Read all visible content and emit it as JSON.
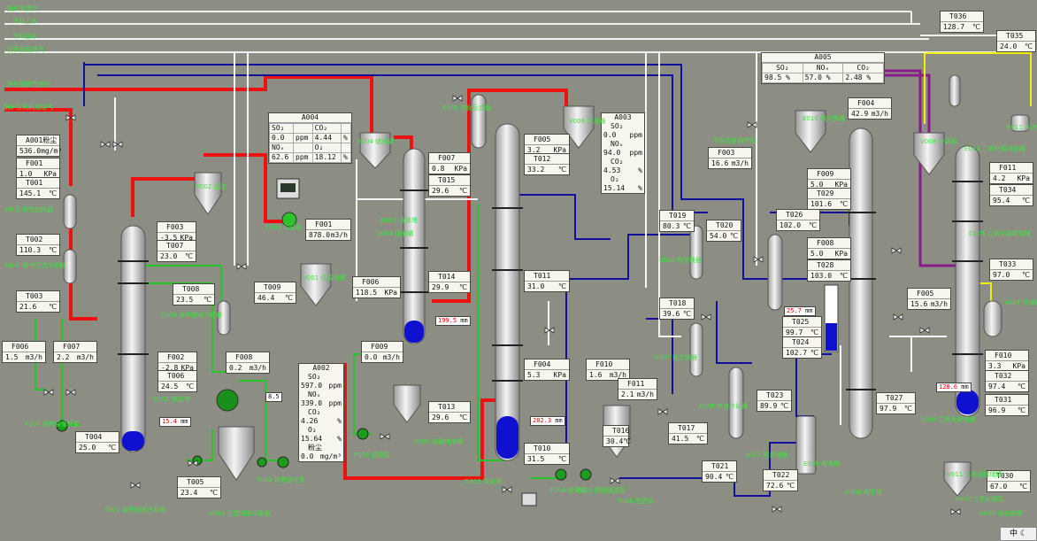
{
  "line_labels": {
    "l1": "锅炉来蒸汽",
    "l2": "冷却上水",
    "l3": "冷却回水",
    "l4": "仪表自控蒸汽",
    "l5": "净化烟道气放空",
    "l6": "锅炉引风机烟道气"
  },
  "readouts": {
    "A001": {
      "tag": "A001粉尘",
      "value": "536.0",
      "unit": "mg/m³"
    },
    "F001a": {
      "tag": "F001",
      "value": "1.0",
      "unit": "KPa"
    },
    "T001": {
      "tag": "T001",
      "value": "145.1",
      "unit": "℃"
    },
    "T002": {
      "tag": "T002",
      "value": "110.3",
      "unit": "℃"
    },
    "T003": {
      "tag": "T003",
      "value": "21.6",
      "unit": "℃"
    },
    "F006": {
      "tag": "F006",
      "value": "1.5",
      "unit": "m3/h"
    },
    "F007": {
      "tag": "F007",
      "value": "2.2",
      "unit": "m3/h"
    },
    "T004": {
      "tag": "T004",
      "value": "25.0",
      "unit": "℃"
    },
    "F003a": {
      "tag": "F003",
      "value": "-3.5",
      "unit": "KPa"
    },
    "T007": {
      "tag": "T007",
      "value": "23.0",
      "unit": "℃"
    },
    "T008": {
      "tag": "T008",
      "value": "23.5",
      "unit": "℃"
    },
    "F002": {
      "tag": "F002",
      "value": "-2.8",
      "unit": "KPa"
    },
    "T006": {
      "tag": "T006",
      "value": "24.5",
      "unit": "℃"
    },
    "F008": {
      "tag": "F008",
      "value": "0.2",
      "unit": "m3/h"
    },
    "T005": {
      "tag": "T005",
      "value": "23.4",
      "unit": "℃"
    },
    "T009": {
      "tag": "T009",
      "value": "46.4",
      "unit": "℃"
    },
    "F001b": {
      "tag": "F001",
      "value": "878.0",
      "unit": "m3/h"
    },
    "F007b": {
      "tag": "F007",
      "value": "0.8",
      "unit": "KPa"
    },
    "T015": {
      "tag": "T015",
      "value": "29.6",
      "unit": "℃"
    },
    "F006b": {
      "tag": "F006",
      "value": "118.5",
      "unit": "KPa"
    },
    "T014": {
      "tag": "T014",
      "value": "29.9",
      "unit": "℃"
    },
    "F009": {
      "tag": "F009",
      "value": "0.0",
      "unit": "m3/h"
    },
    "T013": {
      "tag": "T013",
      "value": "29.6",
      "unit": "℃"
    },
    "F005": {
      "tag": "F005",
      "value": "3.2",
      "unit": "KPa"
    },
    "T012": {
      "tag": "T012",
      "value": "33.2",
      "unit": "℃"
    },
    "T011": {
      "tag": "T011",
      "value": "31.0",
      "unit": "℃"
    },
    "F004": {
      "tag": "F004",
      "value": "5.3",
      "unit": "KPa"
    },
    "T010": {
      "tag": "T010",
      "value": "31.5",
      "unit": "℃"
    },
    "F010": {
      "tag": "F010",
      "value": "1.6",
      "unit": "m3/h"
    },
    "F011": {
      "tag": "F011",
      "value": "2.1",
      "unit": "m3/h"
    },
    "T016": {
      "tag": "T016",
      "value": "30.4",
      "unit": "℃"
    },
    "T017": {
      "tag": "T017",
      "value": "41.5",
      "unit": "℃"
    },
    "T019": {
      "tag": "T019",
      "value": "80.3",
      "unit": "℃"
    },
    "T020": {
      "tag": "T020",
      "value": "54.0",
      "unit": "℃"
    },
    "T018": {
      "tag": "T018",
      "value": "39.6",
      "unit": "℃"
    },
    "T021": {
      "tag": "T021",
      "value": "90.4",
      "unit": "℃"
    },
    "T022": {
      "tag": "T022",
      "value": "72.6",
      "unit": "℃"
    },
    "T023": {
      "tag": "T023",
      "value": "89.9",
      "unit": "℃"
    },
    "F003b": {
      "tag": "F003",
      "value": "16.6",
      "unit": "m3/h"
    },
    "F004b": {
      "tag": "F004",
      "value": "42.9",
      "unit": "m3/h"
    },
    "F009b": {
      "tag": "F009",
      "value": "5.0",
      "unit": "KPa"
    },
    "T029": {
      "tag": "T029",
      "value": "101.6",
      "unit": "℃"
    },
    "T026": {
      "tag": "T026",
      "value": "102.0",
      "unit": "℃"
    },
    "F008b": {
      "tag": "F008",
      "value": "5.0",
      "unit": "KPa"
    },
    "T028": {
      "tag": "T028",
      "value": "103.0",
      "unit": "℃"
    },
    "T025": {
      "tag": "T025",
      "value": "99.7",
      "unit": "℃"
    },
    "T024": {
      "tag": "T024",
      "value": "102.7",
      "unit": "℃"
    },
    "T027": {
      "tag": "T027",
      "value": "97.9",
      "unit": "℃"
    },
    "T036": {
      "tag": "T036",
      "value": "128.7",
      "unit": "℃"
    },
    "T035": {
      "tag": "T035",
      "value": "24.0",
      "unit": "℃"
    },
    "F011b": {
      "tag": "F011",
      "value": "4.2",
      "unit": "KPa"
    },
    "T034": {
      "tag": "T034",
      "value": "95.4",
      "unit": "℃"
    },
    "T033": {
      "tag": "T033",
      "value": "97.0",
      "unit": "℃"
    },
    "F005b": {
      "tag": "F005",
      "value": "15.6",
      "unit": "m3/h"
    },
    "F010b": {
      "tag": "F010",
      "value": "3.3",
      "unit": "KPa"
    },
    "T032": {
      "tag": "T032",
      "value": "97.4",
      "unit": "℃"
    },
    "T031": {
      "tag": "T031",
      "value": "96.9",
      "unit": "℃"
    },
    "T030": {
      "tag": "T030",
      "value": "67.0",
      "unit": "℃"
    }
  },
  "analyzers": {
    "A004": {
      "tag": "A004",
      "r1": [
        "SO₂",
        "CO₂"
      ],
      "r2": [
        "0.0",
        "ppm",
        "4.44",
        "%"
      ],
      "r3": [
        "NOₓ",
        "O₂"
      ],
      "r4": [
        "62.6",
        "ppm",
        "18.12",
        "%"
      ]
    },
    "A002": {
      "tag": "A002",
      "so2": "SO₂",
      "so2v": "597.0",
      "so2u": "ppm",
      "nox": "NOₓ",
      "noxv": "339.0",
      "noxu": "ppm",
      "co2": "CO₂",
      "co2v": "4.26",
      "co2u": "%",
      "o2": "O₂",
      "o2v": "15.64",
      "o2u": "%",
      "dust": "粉尘",
      "dustv": "0.0",
      "dustu": "mg/m³"
    },
    "A003": {
      "tag": "A003",
      "so2": "SO₂",
      "so2v": "0.0",
      "so2u": "ppm",
      "nox": "NOₓ",
      "noxv": "94.0",
      "noxu": "ppm",
      "co2": "CO₂",
      "co2v": "4.53",
      "co2u": "%",
      "o2": "O₂",
      "o2v": "15.14",
      "o2u": "%"
    },
    "A005": {
      "tag": "A005",
      "h": [
        "SO₂",
        "NOₓ",
        "CO₂"
      ],
      "v": [
        "98.5",
        "57.0",
        "2.48"
      ],
      "u": [
        "%",
        "%",
        "%"
      ]
    }
  },
  "levels": {
    "L1": "15.4",
    "L1u": "mm",
    "L2": "199.5",
    "L2u": "mm",
    "L3": "282.3",
    "L3u": "mm",
    "L4": "25.7",
    "L4u": "mm",
    "L5": "128.6",
    "L5u": "mm",
    "P1": "8.5"
  },
  "equipment_labels": [
    "E001 预热加热器",
    "E002 烟气回流冷却器",
    "E003 余热回收冷却器",
    "D001 除尘塔",
    "T001 余热回收冷却塔",
    "V002 沉淀",
    "C001 引风机",
    "V001 低温储罐",
    "P001 余热泵循环泵",
    "P002 余热回收泵",
    "V003 沉淀储液分离器",
    "E004 储液罐",
    "V004 储液罐",
    "D002 洗涤塔",
    "P003 脱硫泵",
    "V005 脱硝储液槽",
    "E005 液化反应器",
    "V006 冷凝器",
    "D003 吸收塔",
    "P004 脱硝泵",
    "P005 脱硝输送泵",
    "P006 回流泵",
    "D004 再生塔",
    "E006 热交换器",
    "E007 热交换器",
    "E008 贫液冷却器",
    "E009 再沸器",
    "E010 热交换器",
    "V007 贫液罐",
    "E011 水汽冷却器",
    "V008 分离器",
    "E012 二氧化碳液化器",
    "D005 二氧化碳精馏塔",
    "V009 二氧化碳储罐",
    "V010 液化储罐",
    "V011 二氧化碳储罐",
    "P007 二氧化碳泵",
    "冷冻流量调节阀",
    "V012 贫液储罐"
  ],
  "tray": {
    "label": "中",
    "icon": "moon-icon"
  },
  "colors": {
    "bg": "#8c8d83",
    "steam": "#ee1111",
    "water": "#10109a",
    "flue": "#f4f4f4",
    "green": "#27c627",
    "purple": "#8a1b8a",
    "yellow": "#eeee10",
    "vessel": "#d8d8d8"
  }
}
